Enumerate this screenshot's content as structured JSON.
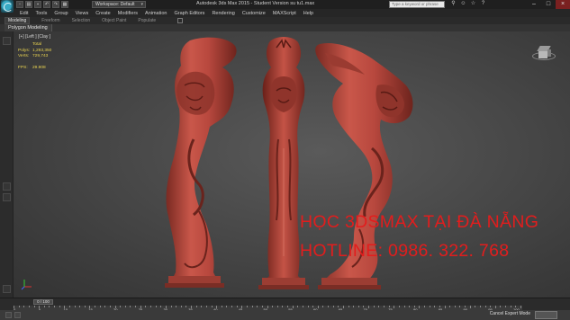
{
  "titlebar": {
    "workspace": "Workspace: Default",
    "title": "Autodesk 3ds Max 2015 - Student Version    su tu1.max",
    "search_placeholder": "Type a keyword or phrase"
  },
  "menu": [
    "Edit",
    "Tools",
    "Group",
    "Views",
    "Create",
    "Modifiers",
    "Animation",
    "Graph Editors",
    "Rendering",
    "Customize",
    "MAXScript",
    "Help"
  ],
  "ribbon": {
    "tabs": [
      "Modeling",
      "Freeform",
      "Selection",
      "Object Paint",
      "Populate"
    ],
    "active_panel": "Polygon Modeling"
  },
  "viewport": {
    "label": "[+] [Left ] [Clay ]",
    "stats": {
      "header": "Total",
      "polys_label": "Polys:",
      "polys_value": "1,293,350",
      "verts_label": "Verts:",
      "verts_value": "729,743",
      "fps_label": "FPS:",
      "fps_value": "29.908"
    },
    "model_color": "#b8483e"
  },
  "watermark": {
    "line1": "HỌC 3DSMAX TẠI ĐÀ NẴNG",
    "line2": "HOTLINE: 0986. 322. 768",
    "color": "#e21d1d"
  },
  "timeline": {
    "frame_slider": "0 / 100",
    "ruler_labels": [
      "0",
      "5",
      "10",
      "15",
      "20",
      "25",
      "30",
      "35",
      "40",
      "45",
      "50",
      "55",
      "60",
      "65",
      "70",
      "75",
      "80",
      "85",
      "90",
      "95",
      "100"
    ]
  },
  "status": {
    "mode": "Cancel Expert Mode"
  }
}
